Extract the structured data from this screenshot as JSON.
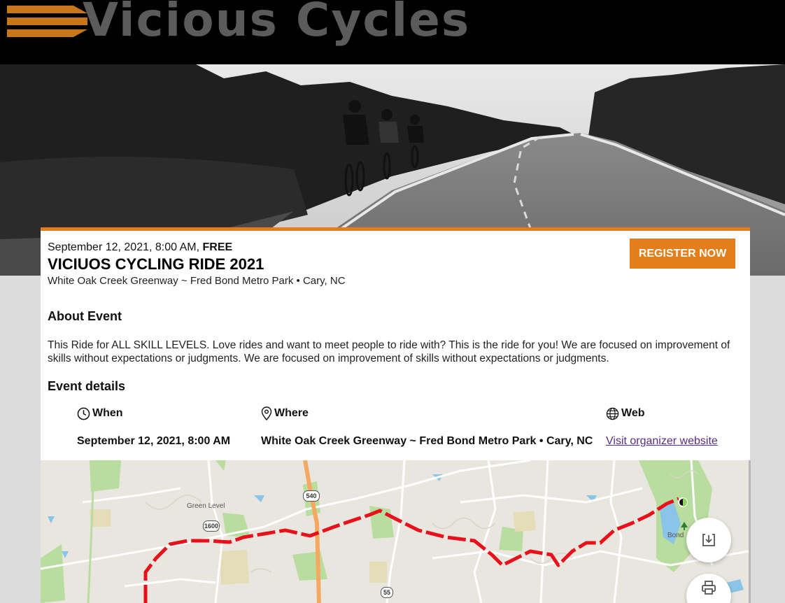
{
  "header": {
    "logo_text": "Vicious Cycles",
    "accent": "#c77619"
  },
  "event": {
    "date": "September 12, 2021, 8:00 AM,",
    "price": "FREE",
    "title": "VICIUOS CYCLING RIDE 2021",
    "location": "White Oak Creek Greenway ~ Fred Bond Metro Park • Cary, NC",
    "register_label": "REGISTER NOW",
    "accent": "#e37e1b"
  },
  "about": {
    "heading": "About Event",
    "text": "This Ride for ALL SKILL LEVELS. Love rides and want to meet people to ride with? This is the ride for you! We are focused on improvement of skills without expectations or judgments. We are focused on improvement of skills without expectations or judgments."
  },
  "details": {
    "heading": "Event details",
    "when_label": "When",
    "when_value": "September 12, 2021, 8:00 AM",
    "where_label": "Where",
    "where_value": "White Oak Creek Greenway ~ Fred Bond Metro Park • Cary, NC",
    "web_label": "Web",
    "web_link": "Visit organizer website"
  },
  "map": {
    "labels": {
      "green_level": "Green Level",
      "bond": "Bond"
    },
    "shields": {
      "r540": "540",
      "r1600": "1600",
      "r55": "55"
    },
    "route_color": "#e8101a"
  }
}
